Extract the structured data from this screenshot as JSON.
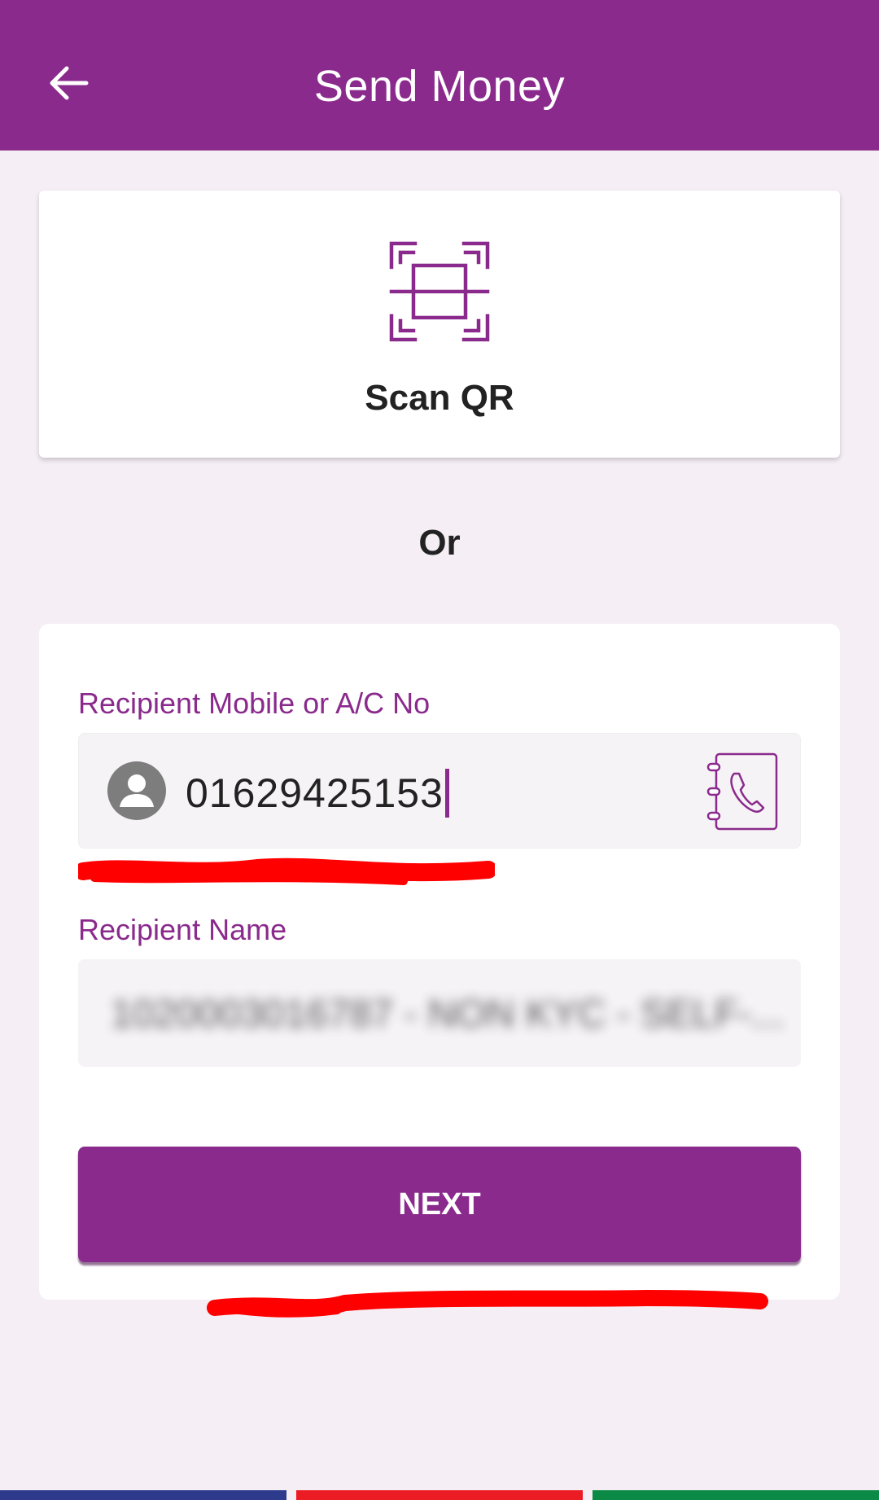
{
  "appbar": {
    "title": "Send Money",
    "back_icon": "arrow-left-icon",
    "color": "#8a2a8c"
  },
  "scan_qr": {
    "label": "Scan QR",
    "icon": "qr-scan-icon"
  },
  "divider_text": "Or",
  "form": {
    "mobile_label": "Recipient Mobile or A/C No",
    "mobile_value": "01629425153",
    "mobile_left_icon": "person-icon",
    "mobile_right_icon": "contacts-book-icon",
    "name_label": "Recipient Name",
    "name_value": "1020003016787 - NON KYC - SELF-..."
  },
  "next_button": {
    "label": "NEXT"
  },
  "colors": {
    "accent": "#8a2a8c",
    "background": "#f5eef5",
    "annotation": "#ff0000",
    "footer_blue": "#2e3a8c",
    "footer_red": "#ec1c24",
    "footer_green": "#0b8a45"
  }
}
